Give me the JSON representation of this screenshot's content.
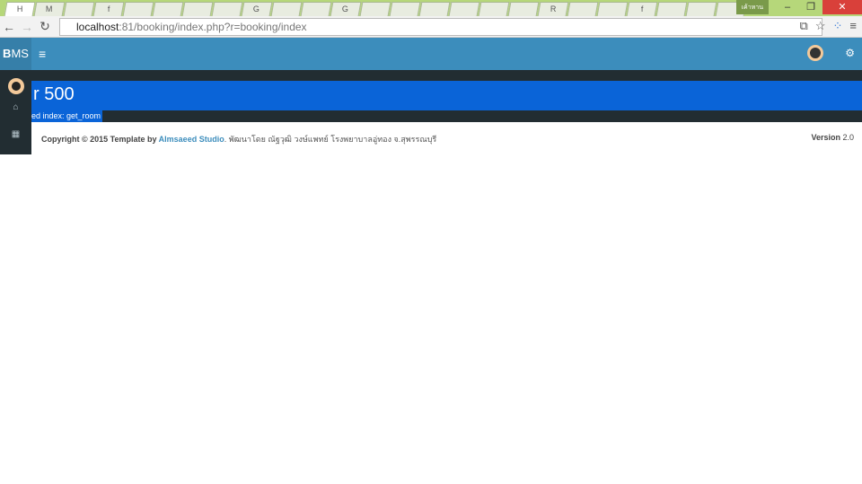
{
  "browser": {
    "tabs": [
      "H",
      "M",
      "",
      "f",
      "",
      "",
      "",
      "",
      "G",
      "",
      "",
      "G",
      "",
      "",
      "",
      "",
      "",
      "",
      "R",
      "",
      "",
      "f",
      "",
      "",
      ""
    ],
    "user_chip": "เค้าหาน",
    "url_host": "localhost",
    "url_rest": ":81/booking/index.php?r=booking/index"
  },
  "header": {
    "logo_bold": "B",
    "logo_rest": "MS"
  },
  "error": {
    "title": "r 500",
    "message": "ed index: get_room"
  },
  "footer": {
    "copyright_prefix": "Copyright © 2015 Template by ",
    "studio_link": "Almsaeed Studio",
    "suffix": ". พัฒนาโดย ณัฐวุฒิ วงษ์แพทย์ โรงพยาบาลอู่ทอง จ.สุพรรณบุรี",
    "version_label": "Version",
    "version_value": "2.0"
  }
}
